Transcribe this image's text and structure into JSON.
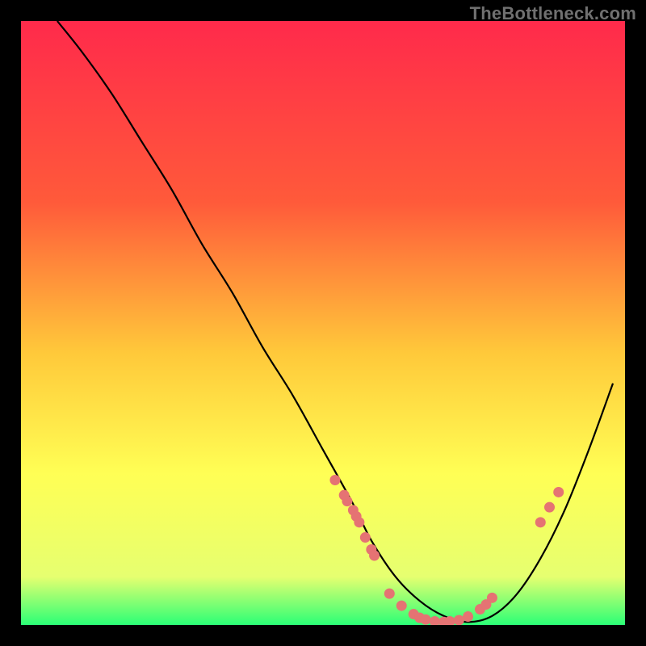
{
  "watermark": "TheBottleneck.com",
  "chart_data": {
    "type": "line",
    "title": "",
    "xlabel": "",
    "ylabel": "",
    "xlim": [
      0,
      100
    ],
    "ylim": [
      0,
      100
    ],
    "gradient_stops": [
      {
        "offset": 0,
        "color": "#ff2a4b"
      },
      {
        "offset": 30,
        "color": "#ff5a3a"
      },
      {
        "offset": 55,
        "color": "#ffc93a"
      },
      {
        "offset": 75,
        "color": "#ffff55"
      },
      {
        "offset": 92,
        "color": "#e6ff70"
      },
      {
        "offset": 100,
        "color": "#2bff76"
      }
    ],
    "curve": {
      "x": [
        6,
        10,
        15,
        20,
        25,
        30,
        35,
        40,
        45,
        50,
        55,
        58,
        62,
        66,
        70,
        74,
        78,
        82,
        86,
        90,
        94,
        98
      ],
      "y": [
        100,
        95,
        88,
        80,
        72,
        63,
        55,
        46,
        38,
        29,
        20,
        14,
        8,
        4,
        1.5,
        0.5,
        1.5,
        5,
        11,
        19,
        29,
        40
      ]
    },
    "left_marker_cluster": {
      "x": [
        52,
        53.5,
        54,
        55,
        55.5,
        56,
        57,
        58,
        58.5
      ],
      "y": [
        24,
        21.5,
        20.5,
        19,
        18,
        17,
        14.5,
        12.5,
        11.5
      ]
    },
    "valley_marker_cluster": {
      "x": [
        61,
        63,
        65,
        66,
        67,
        68.5,
        70,
        71,
        72.5,
        74,
        76,
        77,
        78
      ],
      "y": [
        5.2,
        3.2,
        1.8,
        1.2,
        0.9,
        0.6,
        0.5,
        0.6,
        0.8,
        1.4,
        2.6,
        3.4,
        4.5
      ]
    },
    "right_marker_cluster": {
      "x": [
        86,
        87.5,
        89
      ],
      "y": [
        17,
        19.5,
        22
      ]
    },
    "marker_color": "#e57373",
    "curve_color": "#000000"
  }
}
